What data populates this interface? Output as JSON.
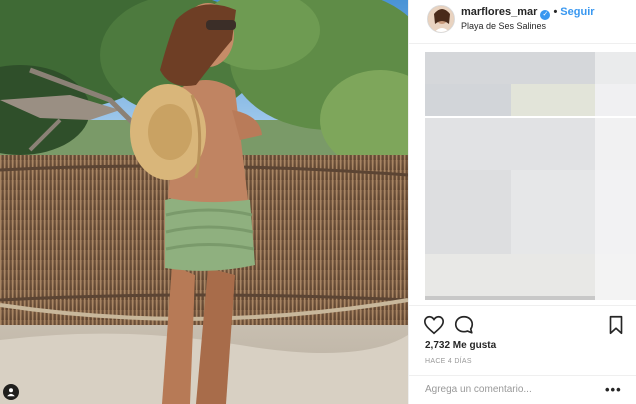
{
  "post": {
    "username": "marflores_mar",
    "verified_badge": "verified-icon",
    "separator": "•",
    "follow_label": "Seguir",
    "location": "Playa de Ses Salines",
    "likes": "2,732 Me gusta",
    "time_ago": "HACE 4 DÍAS",
    "comment_placeholder": "Agrega un comentario...",
    "more_label": "•••"
  },
  "icons": {
    "like": "heart-icon",
    "comment": "comment-icon",
    "save": "bookmark-icon",
    "photo_badge": "user-tag-icon",
    "more": "more-options-icon"
  },
  "colors": {
    "link": "#3897f0",
    "text": "#262626",
    "muted": "#999999",
    "border": "#efefef"
  }
}
